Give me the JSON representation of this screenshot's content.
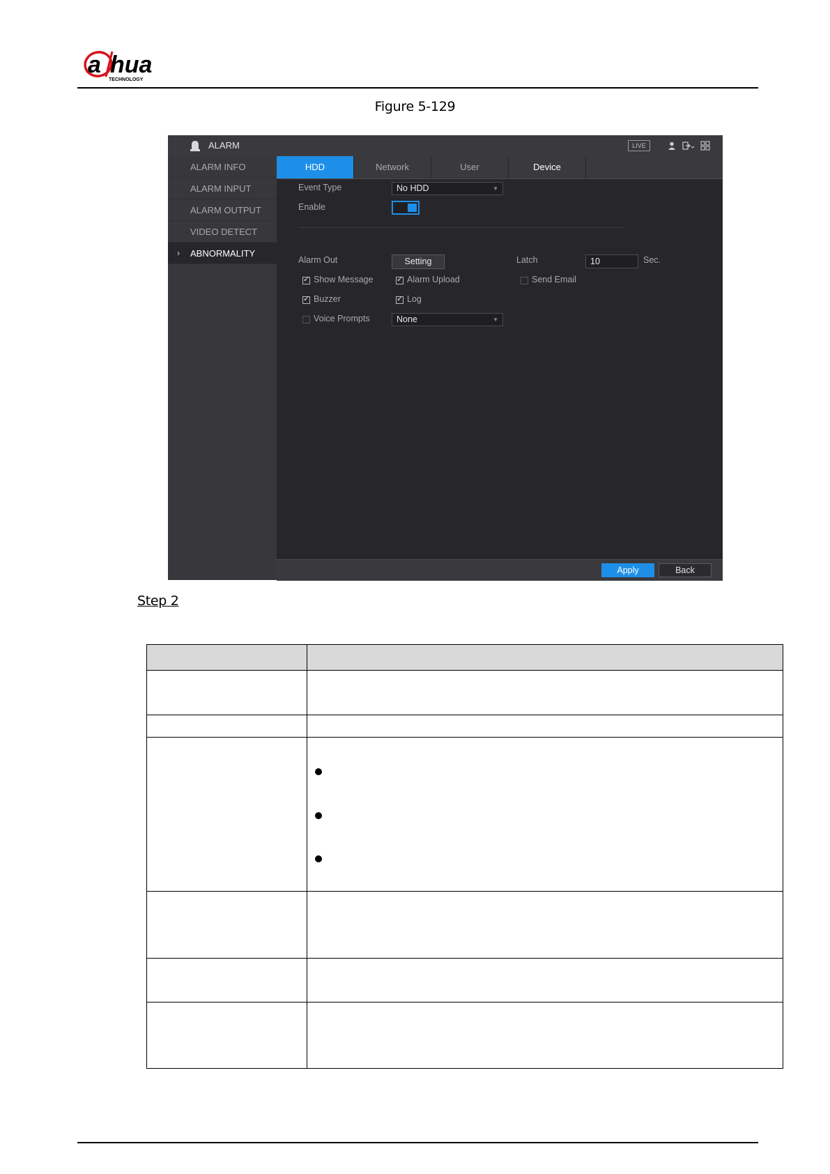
{
  "header": {
    "brand_main": "alhua",
    "brand_sub": "TECHNOLOGY"
  },
  "figure_caption": "Figure 5-129",
  "ui": {
    "window_title": "ALARM",
    "live_badge": "LIVE",
    "sidebar": {
      "items": [
        {
          "label": "ALARM INFO",
          "active": false
        },
        {
          "label": "ALARM INPUT",
          "active": false
        },
        {
          "label": "ALARM OUTPUT",
          "active": false
        },
        {
          "label": "VIDEO DETECT",
          "active": false
        },
        {
          "label": "ABNORMALITY",
          "active": true
        }
      ],
      "active_marker": "›"
    },
    "tabs": [
      {
        "label": "HDD",
        "active": true
      },
      {
        "label": "Network",
        "active": false
      },
      {
        "label": "User",
        "active": false
      },
      {
        "label": "Device",
        "active": false
      }
    ],
    "event_type": {
      "label": "Event Type",
      "value": "No HDD"
    },
    "enable": {
      "label": "Enable",
      "on": true
    },
    "alarm_out": {
      "label": "Alarm Out",
      "button": "Setting"
    },
    "latch": {
      "label": "Latch",
      "value": "10",
      "unit": "Sec."
    },
    "checkboxes": {
      "show_message": {
        "label": "Show Message",
        "checked": true
      },
      "alarm_upload": {
        "label": "Alarm Upload",
        "checked": true
      },
      "send_email": {
        "label": "Send Email",
        "checked": false
      },
      "buzzer": {
        "label": "Buzzer",
        "checked": true
      },
      "log": {
        "label": "Log",
        "checked": true
      },
      "voice_prompts": {
        "label": "Voice Prompts",
        "checked": false
      }
    },
    "voice_prompts_select": "None",
    "check_glyph": "✓",
    "caret_glyph": "▼",
    "footer": {
      "apply": "Apply",
      "back": "Back"
    },
    "colors": {
      "accent": "#1e8fe8",
      "background": "#27272b",
      "panel": "#38383c"
    }
  },
  "step_label": "Step 2"
}
